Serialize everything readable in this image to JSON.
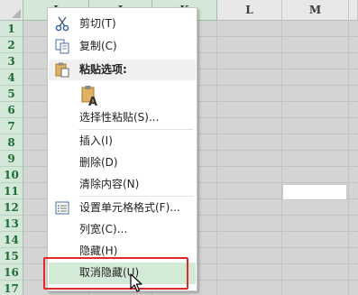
{
  "sheet": {
    "columns": [
      "I",
      "J",
      "K",
      "L",
      "M"
    ],
    "rows": [
      "1",
      "2",
      "3",
      "4",
      "5",
      "6",
      "7",
      "8",
      "9",
      "10",
      "11",
      "12",
      "13",
      "14",
      "15",
      "16",
      "17"
    ]
  },
  "menu": {
    "cut": "剪切(T)",
    "copy": "复制(C)",
    "paste_options": "粘贴选项:",
    "paste_special": "选择性粘贴(S)...",
    "insert": "插入(I)",
    "delete": "删除(D)",
    "clear_contents": "清除内容(N)",
    "format_cells": "设置单元格格式(F)...",
    "column_width": "列宽(C)...",
    "hide": "隐藏(H)",
    "unhide": "取消隐藏(U)"
  },
  "colors": {
    "header_green": "#d3e8d8",
    "row_number_text": "#1e6b33",
    "highlight": "#d3ead6",
    "annotation_red": "#e0292b"
  }
}
